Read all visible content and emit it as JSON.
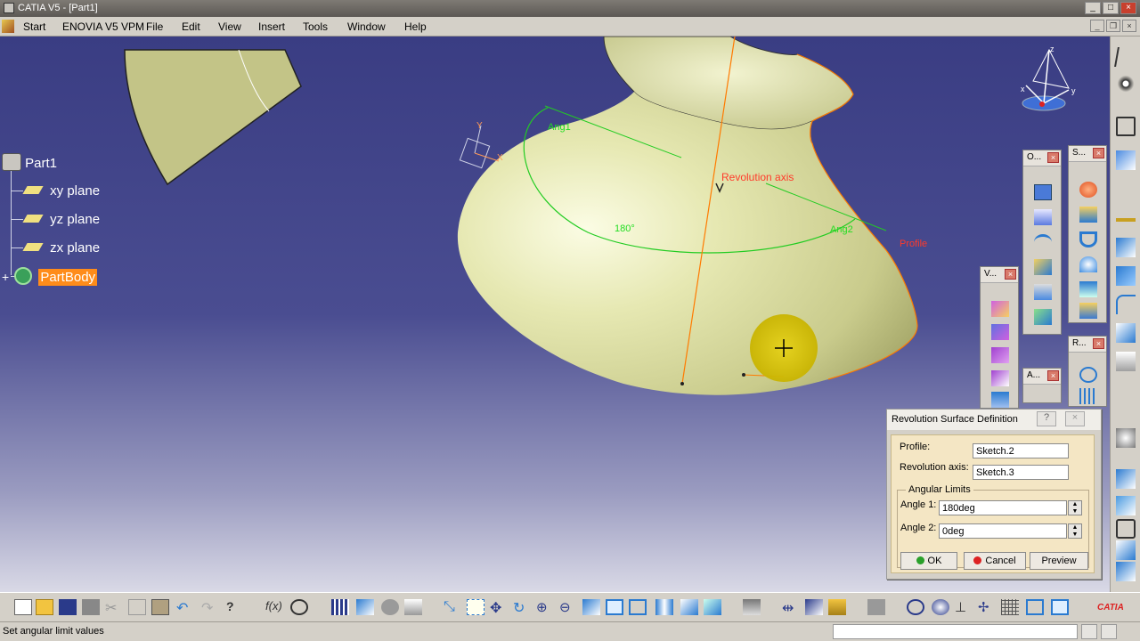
{
  "window": {
    "title": "CATIA V5 - [Part1]"
  },
  "menu": {
    "start": "Start",
    "enovia": "ENOVIA V5 VPM",
    "file": "File",
    "edit": "Edit",
    "view": "View",
    "insert": "Insert",
    "tools": "Tools",
    "window": "Window",
    "help": "Help"
  },
  "tree": {
    "root": "Part1",
    "items": [
      "xy plane",
      "yz plane",
      "zx plane"
    ],
    "body": "PartBody"
  },
  "viewport": {
    "revolution_axis_label": "Revolution axis",
    "angle1_label": "Ang1",
    "angle2_label": "Ang2",
    "angle_value": "180°",
    "profile_label": "Profile",
    "compass_x": "x",
    "compass_y": "y",
    "compass_z": "z",
    "axis_y": "Y",
    "axis_x": "X"
  },
  "toolboxes": {
    "o": "O...",
    "s": "S...",
    "v": "V...",
    "r": "R...",
    "a": "A..."
  },
  "dialog": {
    "title": "Revolution Surface Definition",
    "help": "?",
    "profile_label": "Profile:",
    "profile_value": "Sketch.2",
    "axis_label": "Revolution axis:",
    "axis_value": "Sketch.3",
    "group_label": "Angular Limits",
    "angle1_label": "Angle 1:",
    "angle1_value": "180deg",
    "angle2_label": "Angle 2:",
    "angle2_value": "0deg",
    "ok": "OK",
    "cancel": "Cancel",
    "preview": "Preview"
  },
  "status": {
    "text": "Set angular limit values"
  },
  "colors": {
    "viewport_top": "#3a3d83",
    "surface": "#e6e8b2",
    "highlight_orange": "#ff7a00",
    "green_curve": "#22cc22",
    "partbody_highlight": "#ff8c1a"
  }
}
